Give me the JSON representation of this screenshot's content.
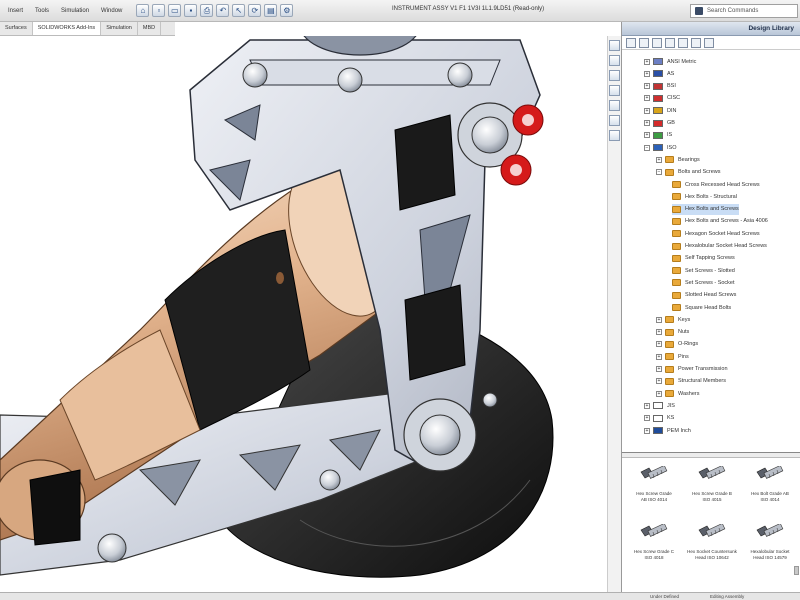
{
  "menu": [
    "Insert",
    "Tools",
    "Simulation",
    "Window"
  ],
  "window_title": "INSTRUMENT ASSY V1 F1 1V3I 1L1.9LD51 (Read-only)",
  "search": {
    "placeholder": "Search Commands"
  },
  "command_tabs": [
    {
      "label": "Surfaces",
      "active": false
    },
    {
      "label": "SOLIDWORKS Add-Ins",
      "active": true
    },
    {
      "label": "Simulation",
      "active": false
    },
    {
      "label": "MBD",
      "active": false
    }
  ],
  "task_pane": {
    "title": "Design Library",
    "tree": [
      {
        "label": "ANSI Metric",
        "level": 1,
        "icon": "flag",
        "color": "#6c7fc4"
      },
      {
        "label": "AS",
        "level": 1,
        "icon": "flag",
        "color": "#2a4fa6"
      },
      {
        "label": "BSI",
        "level": 1,
        "icon": "flag",
        "color": "#c23434"
      },
      {
        "label": "CISC",
        "level": 1,
        "icon": "flag",
        "color": "#cf2f2f"
      },
      {
        "label": "DIN",
        "level": 1,
        "icon": "flag",
        "color": "#d9a51a"
      },
      {
        "label": "GB",
        "level": 1,
        "icon": "flag",
        "color": "#d42a2a"
      },
      {
        "label": "IS",
        "level": 1,
        "icon": "flag",
        "color": "#3c9c42"
      },
      {
        "label": "ISO",
        "level": 1,
        "icon": "flag",
        "color": "#2c61b8",
        "expanded": true
      },
      {
        "label": "Bearings",
        "level": 2,
        "icon": "folder"
      },
      {
        "label": "Bolts and Screws",
        "level": 2,
        "icon": "folder",
        "expanded": true
      },
      {
        "label": "Cross Recessed Head Screws",
        "level": 3,
        "icon": "folder"
      },
      {
        "label": "Hex Bolts - Structural",
        "level": 3,
        "icon": "folder"
      },
      {
        "label": "Hex Bolts and Screws",
        "level": 3,
        "icon": "folder",
        "selected": true
      },
      {
        "label": "Hex Bolts and Screws - Asia 4006",
        "level": 3,
        "icon": "folder"
      },
      {
        "label": "Hexagon Socket Head Screws",
        "level": 3,
        "icon": "folder"
      },
      {
        "label": "Hexalobular Socket Head Screws",
        "level": 3,
        "icon": "folder"
      },
      {
        "label": "Self Tapping Screws",
        "level": 3,
        "icon": "folder"
      },
      {
        "label": "Set Screws - Slotted",
        "level": 3,
        "icon": "folder"
      },
      {
        "label": "Set Screws - Socket",
        "level": 3,
        "icon": "folder"
      },
      {
        "label": "Slotted Head Screws",
        "level": 3,
        "icon": "folder"
      },
      {
        "label": "Square Head Bolts",
        "level": 3,
        "icon": "folder"
      },
      {
        "label": "Keys",
        "level": 2,
        "icon": "folder"
      },
      {
        "label": "Nuts",
        "level": 2,
        "icon": "folder"
      },
      {
        "label": "O-Rings",
        "level": 2,
        "icon": "folder"
      },
      {
        "label": "Pins",
        "level": 2,
        "icon": "folder"
      },
      {
        "label": "Power Transmission",
        "level": 2,
        "icon": "folder"
      },
      {
        "label": "Structural Members",
        "level": 2,
        "icon": "folder"
      },
      {
        "label": "Washers",
        "level": 2,
        "icon": "folder"
      },
      {
        "label": "JIS",
        "level": 1,
        "icon": "flag",
        "color": "#ffffff"
      },
      {
        "label": "KS",
        "level": 1,
        "icon": "flag",
        "color": "#ffffff"
      },
      {
        "label": "PEM Inch",
        "level": 1,
        "icon": "flag",
        "color": "#1f4c9a"
      }
    ],
    "parts": [
      {
        "line1": "Hex Screw Grade",
        "line2": "AB ISO 4014"
      },
      {
        "line1": "Hex Screw Grade B",
        "line2": "ISO 4015"
      },
      {
        "line1": "Hex Bolt Grade AB",
        "line2": "ISO 4014"
      },
      {
        "line1": "Hex Screw Grade C",
        "line2": "ISO 4018"
      },
      {
        "line1": "Hex Socket Countersunk",
        "line2": "Head ISO 10642"
      },
      {
        "line1": "Hexalobular Socket",
        "line2": "Head ISO 14579"
      }
    ]
  },
  "status": {
    "left": "",
    "right1": "Under Defined",
    "right2": "Editing Assembly"
  }
}
